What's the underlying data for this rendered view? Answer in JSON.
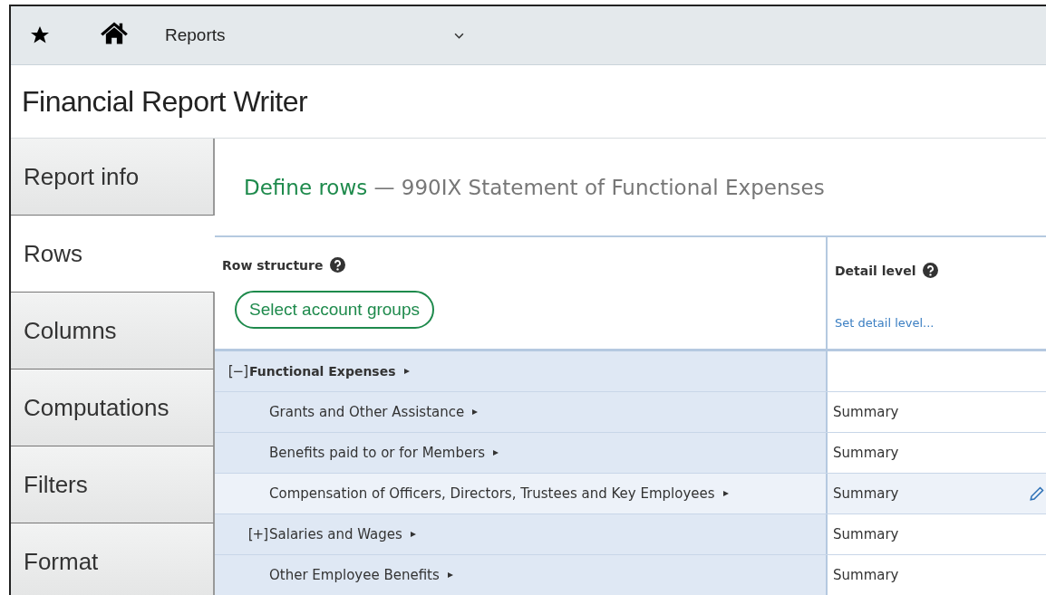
{
  "nav": {
    "label": "Reports"
  },
  "app_title": "Financial Report Writer",
  "sidebar": {
    "items": [
      {
        "label": "Report info",
        "selected": false
      },
      {
        "label": "Rows",
        "selected": true
      },
      {
        "label": "Columns",
        "selected": false
      },
      {
        "label": "Computations",
        "selected": false
      },
      {
        "label": "Filters",
        "selected": false
      },
      {
        "label": "Format",
        "selected": false
      }
    ]
  },
  "heading": {
    "step": "Define rows",
    "separator": "—",
    "report": "990IX Statement of Functional Expenses"
  },
  "table": {
    "columns": [
      {
        "label": "Row structure",
        "action": "Select account groups",
        "kind": "button"
      },
      {
        "label": "Detail level",
        "action": "Set detail level...",
        "kind": "link"
      }
    ],
    "rows": [
      {
        "label": "Functional Expenses",
        "toggle": "[−]",
        "highlighted": false,
        "children": [
          {
            "label": "Grants and Other Assistance",
            "detail": "Summary",
            "highlighted": false
          },
          {
            "label": "Benefits paid to or for Members",
            "detail": "Summary",
            "highlighted": false
          },
          {
            "label": "Compensation of Officers, Directors, Trustees and Key Employees",
            "detail": "Summary",
            "highlighted": true
          },
          {
            "label": "Salaries and Wages",
            "toggle": "[+]",
            "detail": "Summary",
            "highlighted": false
          },
          {
            "label": "Other Employee Benefits",
            "detail": "Summary",
            "highlighted": false
          }
        ]
      }
    ]
  }
}
